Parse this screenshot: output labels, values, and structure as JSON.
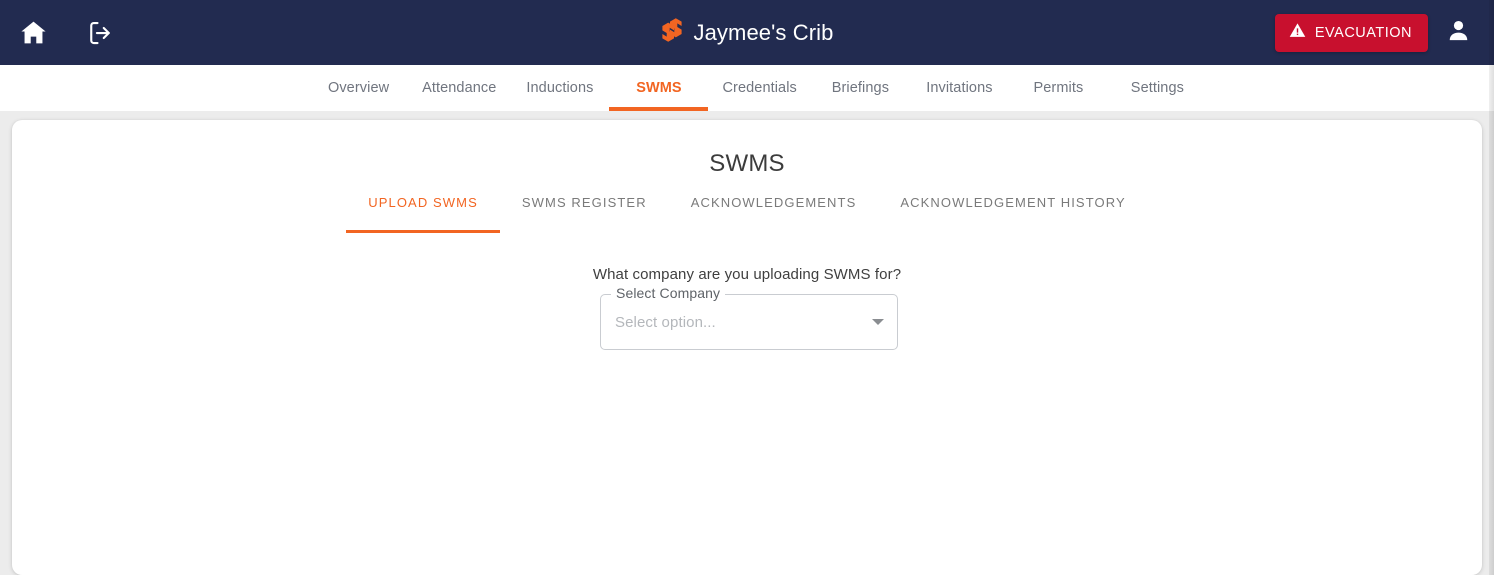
{
  "header": {
    "home_icon": "home-icon",
    "logout_icon": "logout-icon",
    "brand_title": "Jaymee's Crib",
    "brand_logo_icon": "sitepass-logo-icon",
    "evacuation_label": "EVACUATION",
    "evacuation_icon": "warning-triangle-icon",
    "account_icon": "person-icon",
    "bar_color": "#222b50",
    "evacuation_color": "#c8102e"
  },
  "nav": {
    "accent_color": "#f26522",
    "items": [
      {
        "label": "Overview",
        "active": false
      },
      {
        "label": "Attendance",
        "active": false
      },
      {
        "label": "Inductions",
        "active": false
      },
      {
        "label": "SWMS",
        "active": true
      },
      {
        "label": "Credentials",
        "active": false
      },
      {
        "label": "Briefings",
        "active": false
      },
      {
        "label": "Invitations",
        "active": false
      },
      {
        "label": "Permits",
        "active": false
      },
      {
        "label": "Settings",
        "active": false
      }
    ]
  },
  "main": {
    "page_title": "SWMS",
    "tabs": [
      {
        "label": "UPLOAD SWMS",
        "active": true
      },
      {
        "label": "SWMS REGISTER",
        "active": false
      },
      {
        "label": "ACKNOWLEDGEMENTS",
        "active": false
      },
      {
        "label": "ACKNOWLEDGEMENT HISTORY",
        "active": false
      }
    ],
    "form": {
      "question": "What company are you uploading SWMS for?",
      "select_label": "Select Company",
      "select_placeholder": "Select option...",
      "select_value": "",
      "dropdown_icon": "chevron-down-icon"
    }
  }
}
